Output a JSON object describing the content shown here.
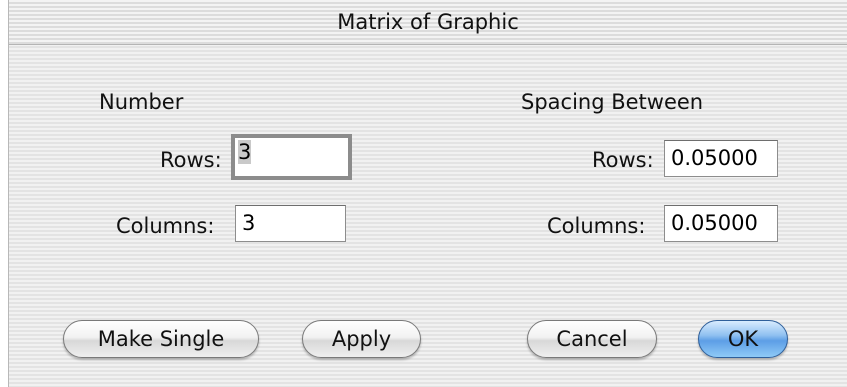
{
  "window": {
    "title": "Matrix of Graphic"
  },
  "number": {
    "heading": "Number",
    "rows_label": "Rows:",
    "rows_value": "3",
    "columns_label": "Columns:",
    "columns_value": "3"
  },
  "spacing": {
    "heading": "Spacing Between",
    "rows_label": "Rows:",
    "rows_value": "0.05000",
    "columns_label": "Columns:",
    "columns_value": "0.05000"
  },
  "buttons": {
    "make_single": "Make Single",
    "apply": "Apply",
    "cancel": "Cancel",
    "ok": "OK"
  },
  "colors": {
    "default_button": "#5d9ee6",
    "focus_ring": "#8c8c8c"
  }
}
